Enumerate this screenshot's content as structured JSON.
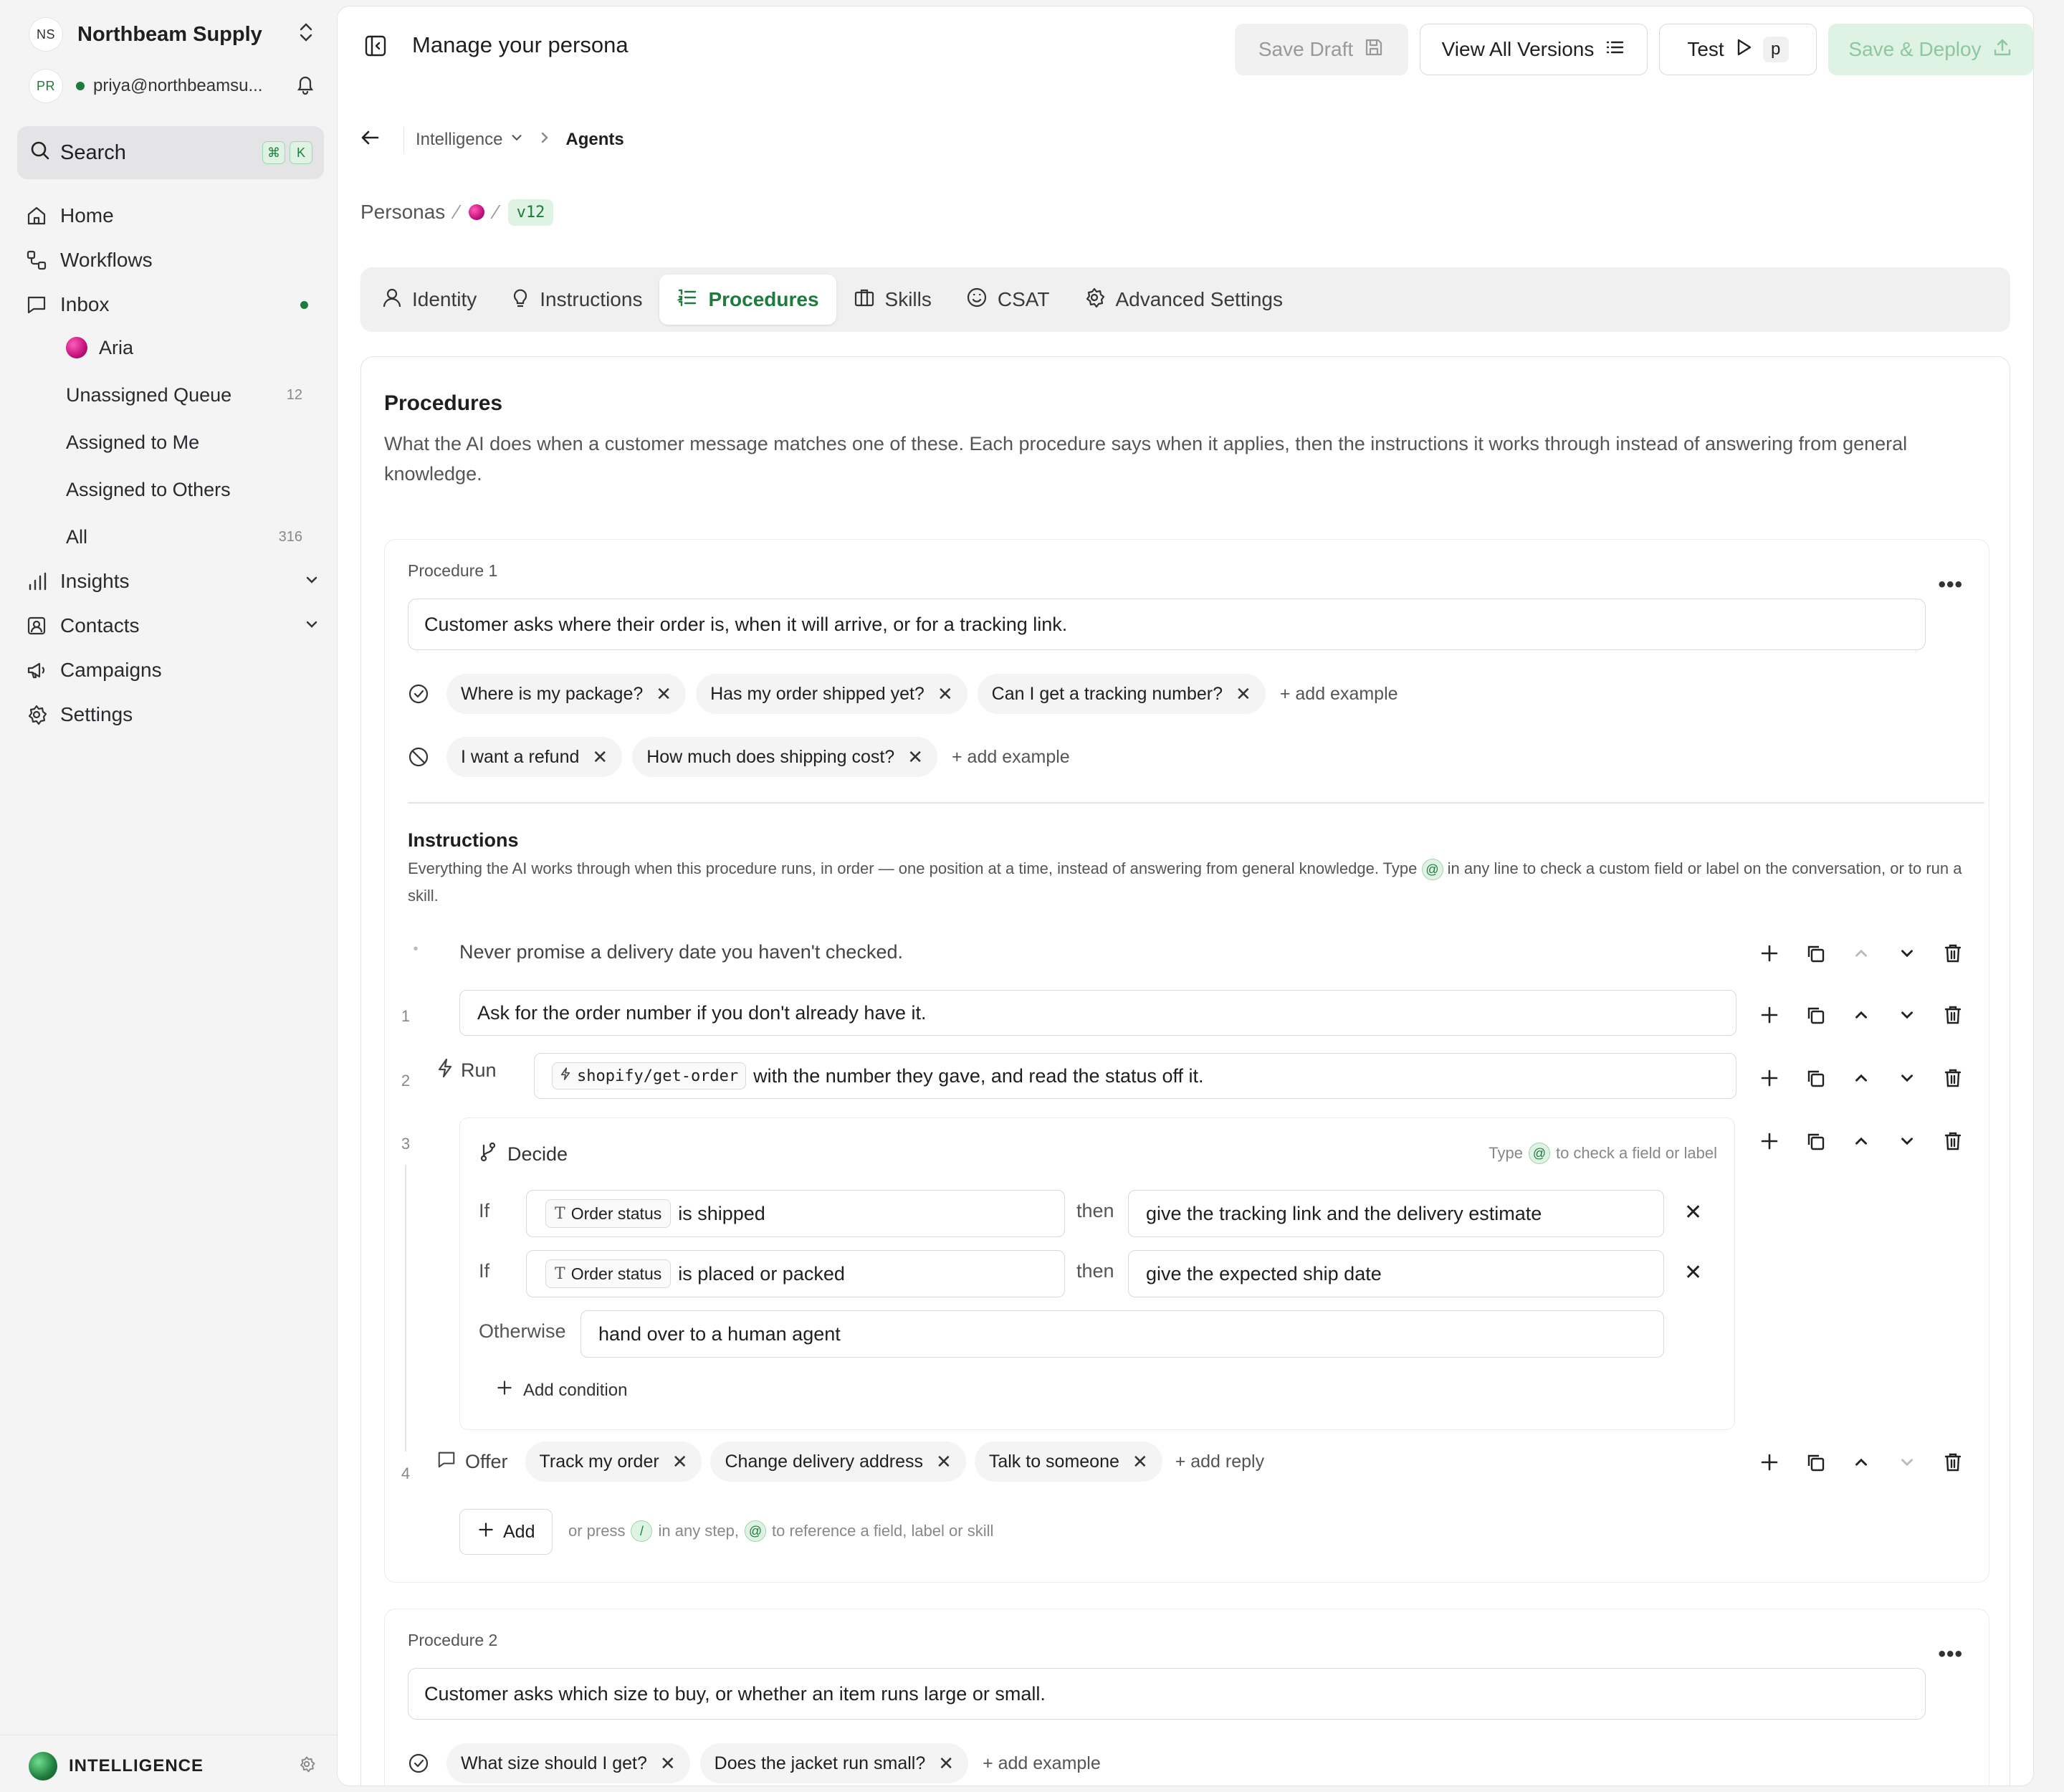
{
  "workspace": {
    "initials": "NS",
    "name": "Northbeam Supply"
  },
  "user": {
    "initials": "PR",
    "email": "priya@northbeamsu..."
  },
  "search": {
    "label": "Search",
    "kbd1": "⌘",
    "kbd2": "K"
  },
  "nav": {
    "home": "Home",
    "workflows": "Workflows",
    "inbox": "Inbox",
    "inbox_items": [
      {
        "label": "Aria"
      },
      {
        "label": "Unassigned Queue",
        "count": "12"
      },
      {
        "label": "Assigned to Me"
      },
      {
        "label": "Assigned to Others"
      },
      {
        "label": "All",
        "count": "316"
      }
    ],
    "insights": "Insights",
    "contacts": "Contacts",
    "campaigns": "Campaigns",
    "settings": "Settings"
  },
  "footer": {
    "label": "INTELLIGENCE"
  },
  "header": {
    "title": "Manage your persona",
    "save_draft": "Save Draft",
    "view_versions": "View All Versions",
    "test": "Test",
    "test_key": "p",
    "deploy": "Save & Deploy"
  },
  "breadcrumb": {
    "parent": "Intelligence",
    "current": "Agents"
  },
  "persona_path": {
    "root": "Personas",
    "version": "v12"
  },
  "tabs": [
    {
      "label": "Identity"
    },
    {
      "label": "Instructions"
    },
    {
      "label": "Procedures"
    },
    {
      "label": "Skills"
    },
    {
      "label": "CSAT"
    },
    {
      "label": "Advanced Settings"
    }
  ],
  "procedures_section": {
    "title": "Procedures",
    "description": "What the AI does when a customer message matches one of these. Each procedure says when it applies, then the instructions it works through instead of answering from general knowledge."
  },
  "procedure1": {
    "label": "Procedure 1",
    "trigger": "Customer asks where their order is, when it will arrive, or for a tracking link.",
    "positive_examples": [
      "Where is my package?",
      "Has my order shipped yet?",
      "Can I get a tracking number?"
    ],
    "negative_examples": [
      "I want a refund",
      "How much does shipping cost?"
    ],
    "add_example": "+ add example",
    "instructions_title": "Instructions",
    "instructions_desc_a": "Everything the AI works through when this procedure runs, in order — one position at a time, instead of answering from general knowledge. Type",
    "instructions_desc_b": "in any line to check a custom field or label on the conversation, or to run a skill.",
    "at": "@",
    "rule": "Never promise a delivery date you haven't checked.",
    "step1": {
      "num": "1",
      "text": "Ask for the order number if you don't already have it."
    },
    "step2": {
      "num": "2",
      "verb": "Run",
      "tool": "shopify/get-order",
      "text": "with the number they gave, and read the status off it."
    },
    "step3": {
      "num": "3",
      "verb": "Decide",
      "hint_a": "Type",
      "hint_b": "to check a field or label",
      "if_label": "If",
      "then_label": "then",
      "conditions": [
        {
          "field": "Order status",
          "op": "is shipped",
          "then": "give the tracking link and the delivery estimate"
        },
        {
          "field": "Order status",
          "op": "is placed or packed",
          "then": "give the expected ship date"
        }
      ],
      "otherwise_label": "Otherwise",
      "otherwise": "hand over to a human agent",
      "add_condition": "Add condition"
    },
    "step4": {
      "num": "4",
      "verb": "Offer",
      "replies": [
        "Track my order",
        "Change delivery address",
        "Talk to someone"
      ],
      "add_reply": "+ add reply"
    },
    "add_btn": "Add",
    "add_hint_a": "or press",
    "add_hint_slash": "/",
    "add_hint_b": "in any step,",
    "add_hint_c": "to reference a field, label or skill"
  },
  "procedure2": {
    "label": "Procedure 2",
    "trigger": "Customer asks which size to buy, or whether an item runs large or small.",
    "positive_examples": [
      "What size should I get?",
      "Does the jacket run small?"
    ],
    "add_example": "+ add example"
  }
}
